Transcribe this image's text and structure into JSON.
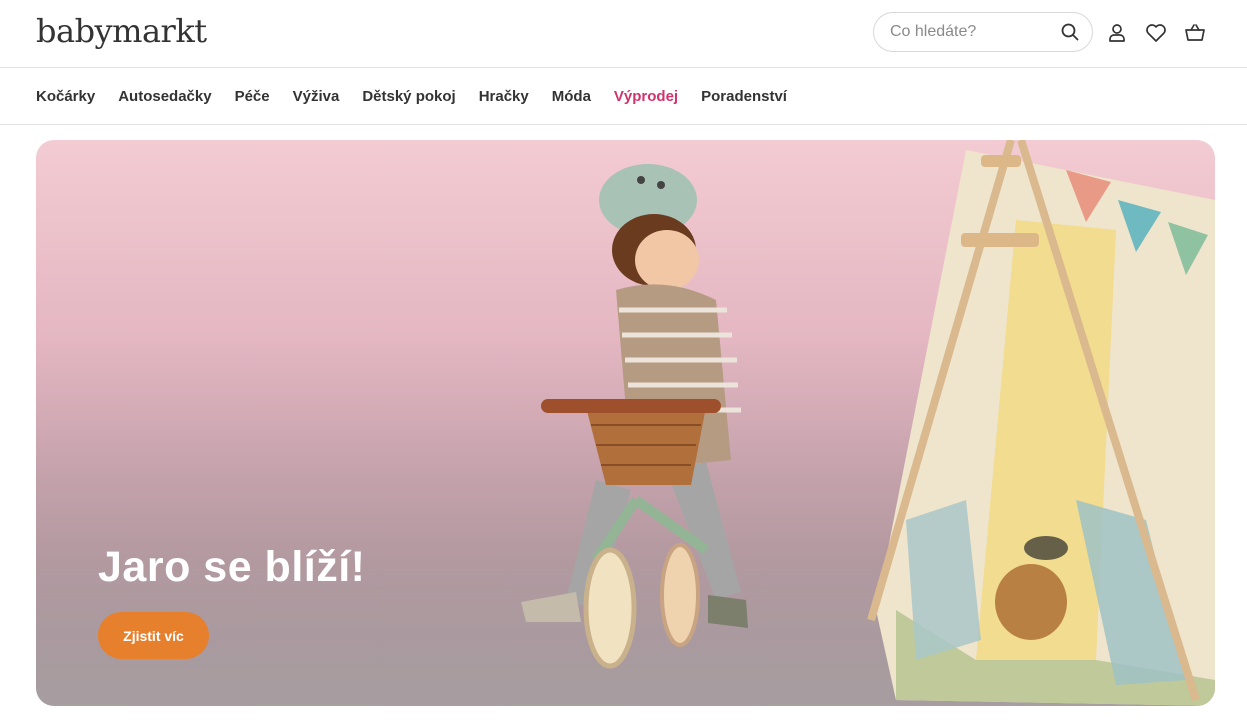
{
  "header": {
    "logo": "babymarkt",
    "search_placeholder": "Co hledáte?",
    "icons": [
      "search-icon",
      "user-icon",
      "heart-icon",
      "basket-icon"
    ]
  },
  "nav": {
    "items": [
      "Kočárky",
      "Autosedačky",
      "Péče",
      "Výživa",
      "Dětský pokoj",
      "Hračky",
      "Móda",
      "Výprodej",
      "Poradenství"
    ],
    "highlight": "Výprodej",
    "highlight_color": "#d0336d"
  },
  "hero": {
    "title": "Jaro se blíží!",
    "button_label": "Zjistit víc",
    "button_color": "#e6802d"
  }
}
